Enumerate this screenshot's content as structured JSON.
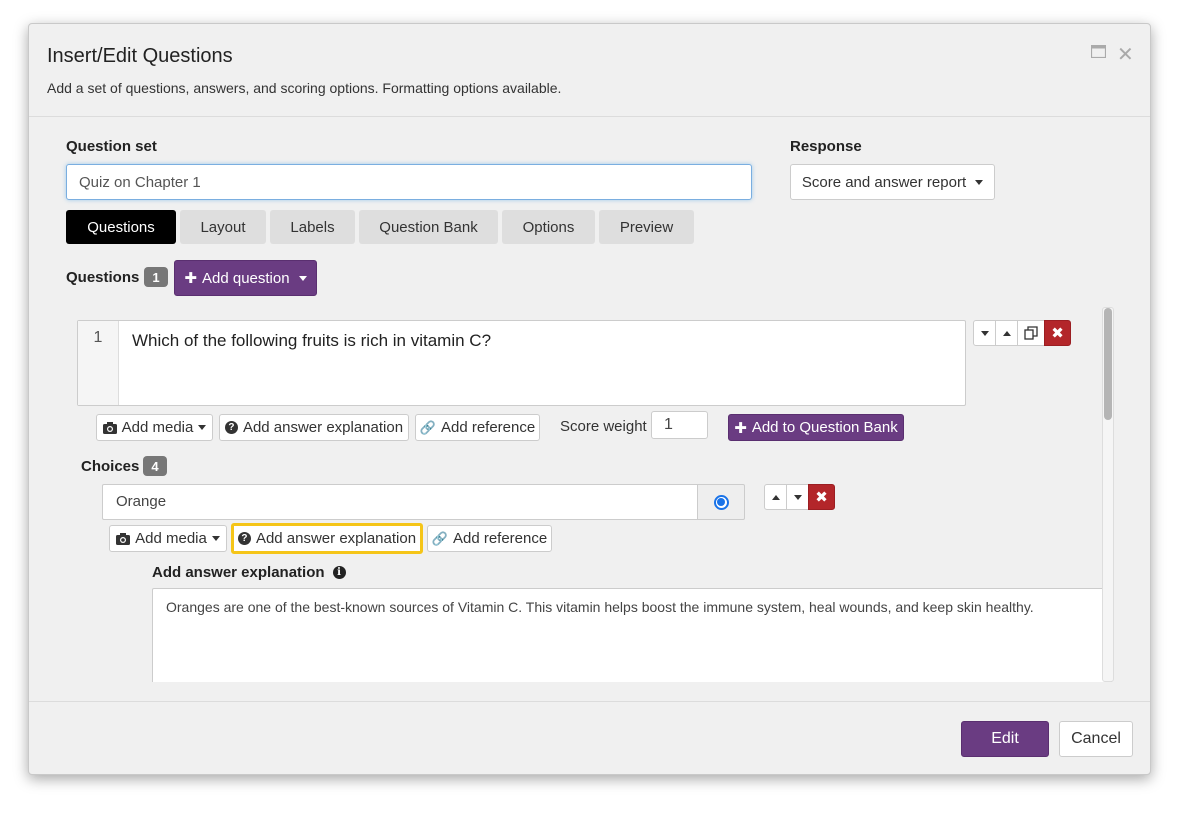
{
  "dialog": {
    "title": "Insert/Edit Questions",
    "subtitle": "Add a set of questions, answers, and scoring options. Formatting options available.",
    "maximize_icon": "window-maximize-icon",
    "close_icon": "close-icon"
  },
  "question_set": {
    "label": "Question set",
    "value": "Quiz on Chapter 1"
  },
  "response": {
    "label": "Response",
    "selected": "Score and answer report"
  },
  "tabs": [
    {
      "label": "Questions",
      "active": true
    },
    {
      "label": "Layout"
    },
    {
      "label": "Labels"
    },
    {
      "label": "Question Bank"
    },
    {
      "label": "Options"
    },
    {
      "label": "Preview"
    }
  ],
  "questions": {
    "label": "Questions",
    "count": "1",
    "add_button": "Add question"
  },
  "question": {
    "number": "1",
    "text": "Which of the following fruits is rich in vitamin C?",
    "add_media": "Add media",
    "add_explanation": "Add answer explanation",
    "add_reference": "Add reference",
    "score_weight_label": "Score weight",
    "score_weight": "1",
    "add_to_bank": "Add to Question Bank"
  },
  "choices": {
    "label": "Choices",
    "count": "4",
    "items": [
      {
        "text": "Orange",
        "correct": true,
        "add_media": "Add media",
        "add_explanation": "Add answer explanation",
        "add_reference": "Add reference",
        "explanation_label": "Add answer explanation",
        "explanation_text": "Oranges are one of the best-known sources of Vitamin C. This vitamin helps boost the immune system, heal wounds, and keep skin healthy."
      }
    ]
  },
  "footer": {
    "edit": "Edit",
    "cancel": "Cancel"
  },
  "colors": {
    "accent_purple": "#6a3c82",
    "danger_red": "#b3262a",
    "highlight_yellow": "#f5c518",
    "radio_blue": "#1a73e8"
  }
}
